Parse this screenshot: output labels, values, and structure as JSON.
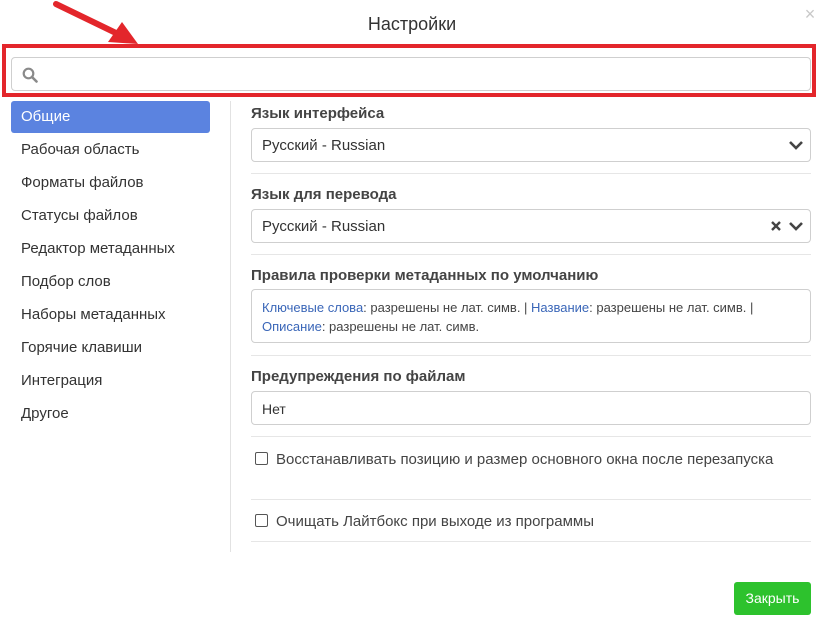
{
  "dialog": {
    "title": "Настройки",
    "close_symbol": "×"
  },
  "search": {
    "value": "",
    "placeholder": ""
  },
  "sidebar": {
    "items": [
      {
        "label": "Общие",
        "active": true
      },
      {
        "label": "Рабочая область",
        "active": false
      },
      {
        "label": "Форматы файлов",
        "active": false
      },
      {
        "label": "Статусы файлов",
        "active": false
      },
      {
        "label": "Редактор метаданных",
        "active": false
      },
      {
        "label": "Подбор слов",
        "active": false
      },
      {
        "label": "Наборы метаданных",
        "active": false
      },
      {
        "label": "Горячие клавиши",
        "active": false
      },
      {
        "label": "Интеграция",
        "active": false
      },
      {
        "label": "Другое",
        "active": false
      }
    ]
  },
  "settings": {
    "interface_language": {
      "label": "Язык интерфейса",
      "value": "Русский - Russian"
    },
    "translation_language": {
      "label": "Язык для перевода",
      "value": "Русский - Russian"
    },
    "metadata_rules": {
      "label": "Правила проверки метаданных по умолчанию",
      "keywords_key": "Ключевые слова",
      "keywords_value": ": разрешены не лат. симв. | ",
      "title_key": "Название",
      "title_value": ": разрешены не лат. симв. |",
      "description_key": "Описание",
      "description_value": ": разрешены не лат. симв."
    },
    "file_warnings": {
      "label": "Предупреждения по файлам",
      "value": "Нет"
    },
    "restore_window": {
      "label": "Восстанавливать позицию и размер основного окна после перезапуска",
      "checked": false
    },
    "clear_lightbox": {
      "label": "Очищать Лайтбокс при выходе из программы",
      "checked": false
    }
  },
  "footer": {
    "close_button": "Закрыть"
  },
  "colors": {
    "accent": "#5b83e0",
    "highlight": "#e3262b",
    "button": "#2dc22d",
    "link": "#3a66b8"
  }
}
